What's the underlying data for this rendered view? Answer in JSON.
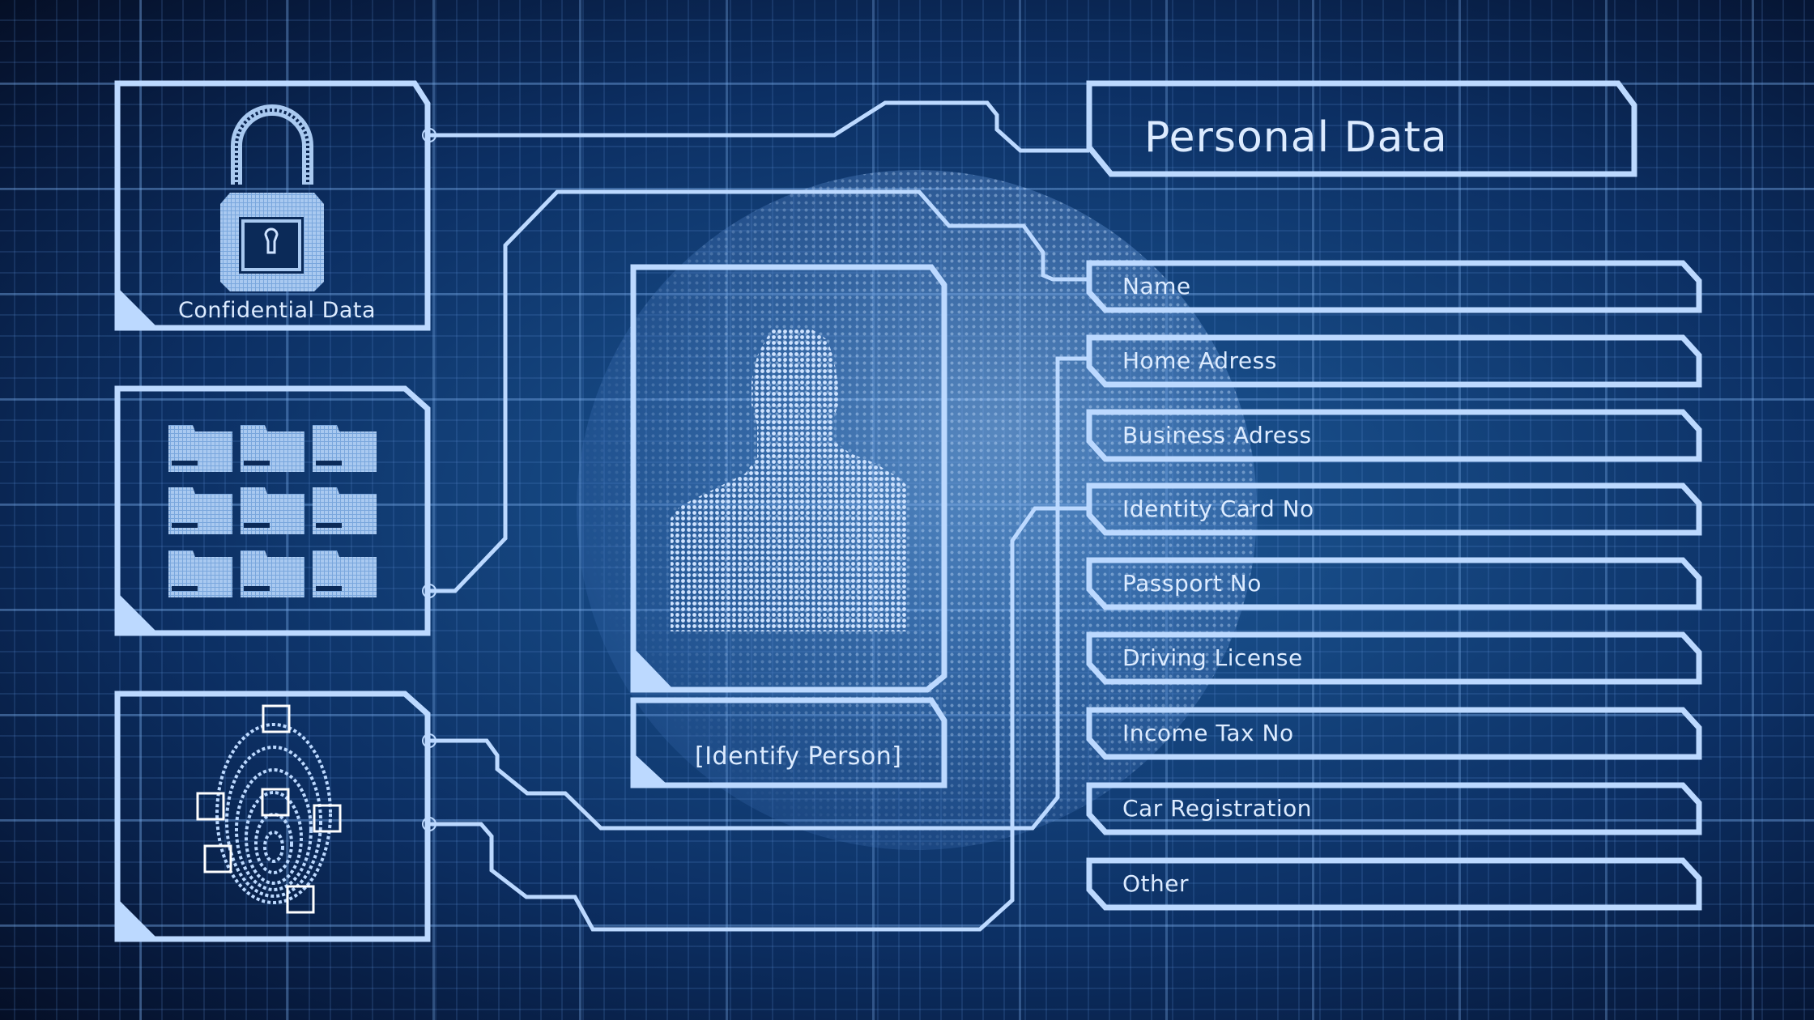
{
  "background": {
    "base_color": "#0c2f63",
    "line_color": "#bcd9ff"
  },
  "left_panels": [
    {
      "id": "confidential",
      "label": "Confidential Data",
      "icon": "padlock-icon"
    },
    {
      "id": "files",
      "label": "",
      "icon": "folders-grid-icon",
      "folder_count": 9
    },
    {
      "id": "biometrics",
      "label": "",
      "icon": "fingerprint-icon"
    }
  ],
  "center": {
    "portrait_icon": "person-silhouette-icon",
    "identify_button_label": "[Identify Person]"
  },
  "right": {
    "title": "Personal Data",
    "fields": [
      {
        "label": "Name"
      },
      {
        "label": "Home Adress"
      },
      {
        "label": "Business Adress"
      },
      {
        "label": "Identity Card No"
      },
      {
        "label": "Passport No"
      },
      {
        "label": "Driving License"
      },
      {
        "label": "Income Tax No"
      },
      {
        "label": "Car Registration"
      },
      {
        "label": "Other"
      }
    ]
  }
}
